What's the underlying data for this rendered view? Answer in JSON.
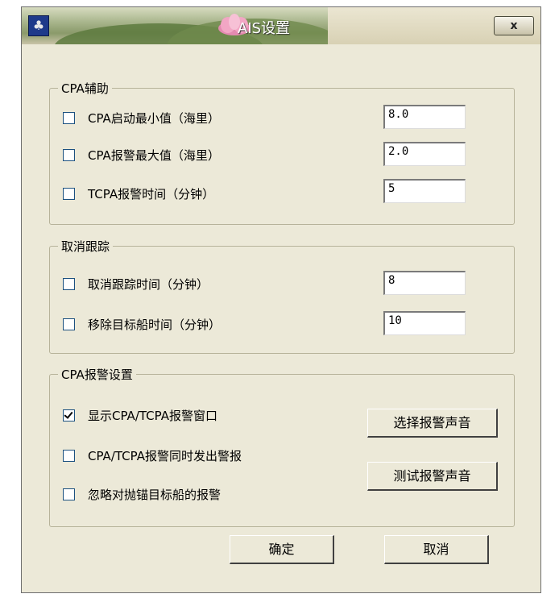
{
  "window": {
    "title": "AIS设置",
    "app_icon": "app-logo-icon",
    "close_label": "x"
  },
  "cpa_assist": {
    "legend": "CPA辅助",
    "rows": [
      {
        "label": "CPA启动最小值（海里）",
        "checked": false,
        "value": "8.0"
      },
      {
        "label": "CPA报警最大值（海里）",
        "checked": false,
        "value": "2.0"
      },
      {
        "label": "TCPA报警时间（分钟）",
        "checked": false,
        "value": "5"
      }
    ]
  },
  "cancel_tracking": {
    "legend": "取消跟踪",
    "rows": [
      {
        "label": "取消跟踪时间（分钟）",
        "checked": false,
        "value": "8"
      },
      {
        "label": "移除目标船时间（分钟）",
        "checked": false,
        "value": "10"
      }
    ]
  },
  "cpa_alarm": {
    "legend": "CPA报警设置",
    "rows": [
      {
        "label": "显示CPA/TCPA报警窗口",
        "checked": true
      },
      {
        "label": "CPA/TCPA报警同时发出警报",
        "checked": false
      },
      {
        "label": "忽略对抛锚目标船的报警",
        "checked": false
      }
    ],
    "select_sound_button": "选择报警声音",
    "test_sound_button": "测试报警声音"
  },
  "footer": {
    "ok_button": "确定",
    "cancel_button": "取消"
  }
}
